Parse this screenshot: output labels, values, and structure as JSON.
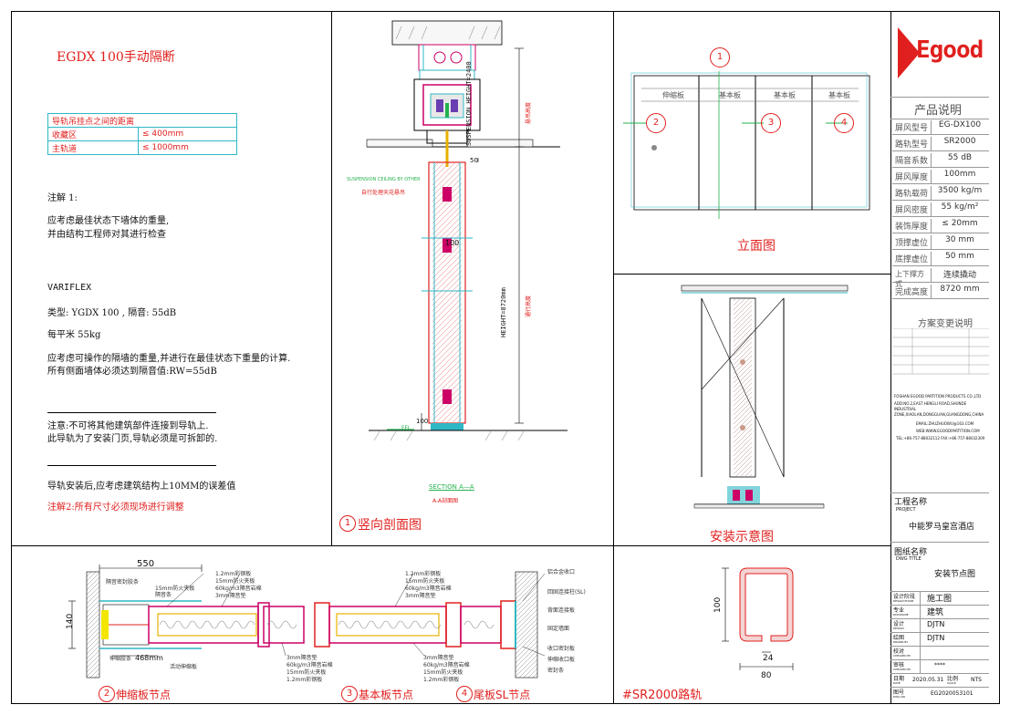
{
  "notes": {
    "title": "EGDX 100手动隔断",
    "spec_header": "导轨吊挂点之间的距离",
    "spec_rows": [
      {
        "label": "收藏区",
        "value": "≤ 400mm"
      },
      {
        "label": "主轨道",
        "value": "≤ 1000mm"
      }
    ],
    "note1_title": "注解 1:",
    "note1_line1": "应考虑最佳状态下墙体的重量,",
    "note1_line2": "并由结构工程师对其进行检查",
    "brand": "VARIFLEX",
    "type_line": "类型:  YGDX 100 , 隔音:  55dB",
    "weight_line": "每平米 55kg",
    "calc_line1": "应考虑可操作的隔墙的重量,并进行在最佳状态下重量的计算.",
    "calc_line2": "所有侧面墙体必须达到隔音值:RW=55dB",
    "warn_line1": "注意:不可将其他建筑部件连接到导轨上.",
    "warn_line2": "此导轨为了安装门页,导轨必须是可拆卸的.",
    "install_line": "导轨安装后,应考虑建筑结构上10MM的误差值",
    "note2": "注解2:所有尺寸必须现场进行调整"
  },
  "section": {
    "suspension_height": "SUSPENSION HEIGHT=2400",
    "height": "HEIGHT=8720mm",
    "suspension_ceiling": "SUSPENSION CEILING BY OTHER",
    "ceiling_cn": "自行处理天花悬吊",
    "dim_50": "50",
    "dim_100": "100",
    "dim_100_bottom": "100",
    "ffl": "FFL",
    "section_title": "SECTION  A—A",
    "section_sub": "A-A剖面图",
    "side_label_1": "悬吊高度",
    "side_label_2": "通行高度",
    "caption_no": "1",
    "caption": "竖向剖面图"
  },
  "elevation": {
    "markers": [
      "1",
      "2",
      "3",
      "4"
    ],
    "panels": [
      "伸缩板",
      "基本板",
      "基本板",
      "基本板"
    ],
    "caption": "立面图"
  },
  "install": {
    "caption": "安装示意图"
  },
  "nodes": {
    "dim_550": "550",
    "dim_140": "140",
    "dim_468": "468mm",
    "left_labels": [
      "隔音密封胶条",
      "隔音条",
      "伸缩胶条"
    ],
    "left_top_labels": [
      "15mm防火夹板",
      "1.2mm彩钢板",
      "15mm防火夹板",
      "60kg/m3隔音岩棉",
      "3mm隔音垫"
    ],
    "left_bottom_labels": [
      "活动伸缩板"
    ],
    "mid_bottom_labels": [
      "3mm隔音垫",
      "60kg/m3隔音岩棉",
      "15mm防火夹板",
      "1.2mm彩钢板"
    ],
    "mid_top_labels": [
      "1.2mm彩钢板",
      "15mm防火夹板",
      "60kg/m3隔音岩棉",
      "3mm隔音垫"
    ],
    "right_bottom_labels": [
      "3mm隔音垫",
      "60kg/m3隔音岩棉",
      "15mm防火夹板",
      "1.2mm彩钢板"
    ],
    "right_labels": [
      "铝合金收口",
      "回固连接柱(SL)",
      "背面连接板",
      "固定墙面",
      "收口密封板",
      "伸缩收口板",
      "密封条"
    ],
    "caption_2_no": "2",
    "caption_2": "伸缩板节点",
    "caption_3_no": "3",
    "caption_3": "基本板节点",
    "caption_4_no": "4",
    "caption_4": "尾板SL节点"
  },
  "rail": {
    "dim_100": "100",
    "dim_24": "24",
    "dim_80": "80",
    "caption": "#SR2000路轨"
  },
  "title_block": {
    "logo": "Egood",
    "product_title": "产品说明",
    "rows": [
      {
        "k": "屏风型号",
        "v": "EG-DX100"
      },
      {
        "k": "路轨型号",
        "v": "SR2000"
      },
      {
        "k": "隔音系数",
        "v": "55 dB"
      },
      {
        "k": "屏风厚度",
        "v": "100mm"
      },
      {
        "k": "路轨载荷",
        "v": "3500 kg/m"
      },
      {
        "k": "屏风密度",
        "v": "55 kg/m²"
      },
      {
        "k": "装饰厚度",
        "v": "≤ 20mm"
      },
      {
        "k": "顶撑虚位",
        "v": "30 mm"
      },
      {
        "k": "底撑虚位",
        "v": "50 mm"
      },
      {
        "k": "上下撑方式",
        "v": "连续撬动"
      },
      {
        "k": "完成高度",
        "v": "8720 mm"
      }
    ],
    "changes_title": "方案变更说明",
    "company": "FOSHAN EGOOD PARTITION PRODUCTS CO.,LTD",
    "address": "ADD:NO.2,EAST HENGLI ROAD,SHUNDE INDUSTRIAL ZONE,XIAOLAN,DONGGUAN,GUANGDONG,CHINA",
    "email": "EMAIL:ZHUZHUOWU@163.COM",
    "web": "WEB:WWW.EGOODPARTITION.COM",
    "tel": "TEL:+86-757-88032112  FAX:+86-757-88032309",
    "project_label": "工程名称",
    "project_label_en": "PROJECT",
    "project": "中能罗马皇宫酒店",
    "drawing_label": "图纸名称",
    "drawing_label_en": "DWG TITLE",
    "drawing": "安装节点图",
    "meta": [
      {
        "k": "设计阶段",
        "en": "DESIGN PHASE",
        "v": "施工图"
      },
      {
        "k": "专业",
        "en": "DISCIPLINE",
        "v": "建筑"
      },
      {
        "k": "设计",
        "en": "DESIGN",
        "v": "DJTN"
      },
      {
        "k": "绘图",
        "en": "DRAWN BY",
        "v": "DJTN"
      },
      {
        "k": "校对",
        "en": "CHECKED BY",
        "v": ""
      },
      {
        "k": "审核",
        "en": "CHECKED BY",
        "v": "****"
      }
    ],
    "date_label": "日期",
    "date_en": "DATE",
    "date": "2020.05.31",
    "scale_label": "比例",
    "scale_en": "SCALE",
    "scale": "NTS",
    "drawing_no_label": "图号",
    "drawing_no_en": "DWG NO",
    "drawing_no": "EG2020053101"
  },
  "colors": {
    "red": "#e0201e",
    "cyan": "#2fb7c4",
    "magenta": "#cc0066",
    "green": "#23b14d",
    "yellow": "#f2e600"
  }
}
